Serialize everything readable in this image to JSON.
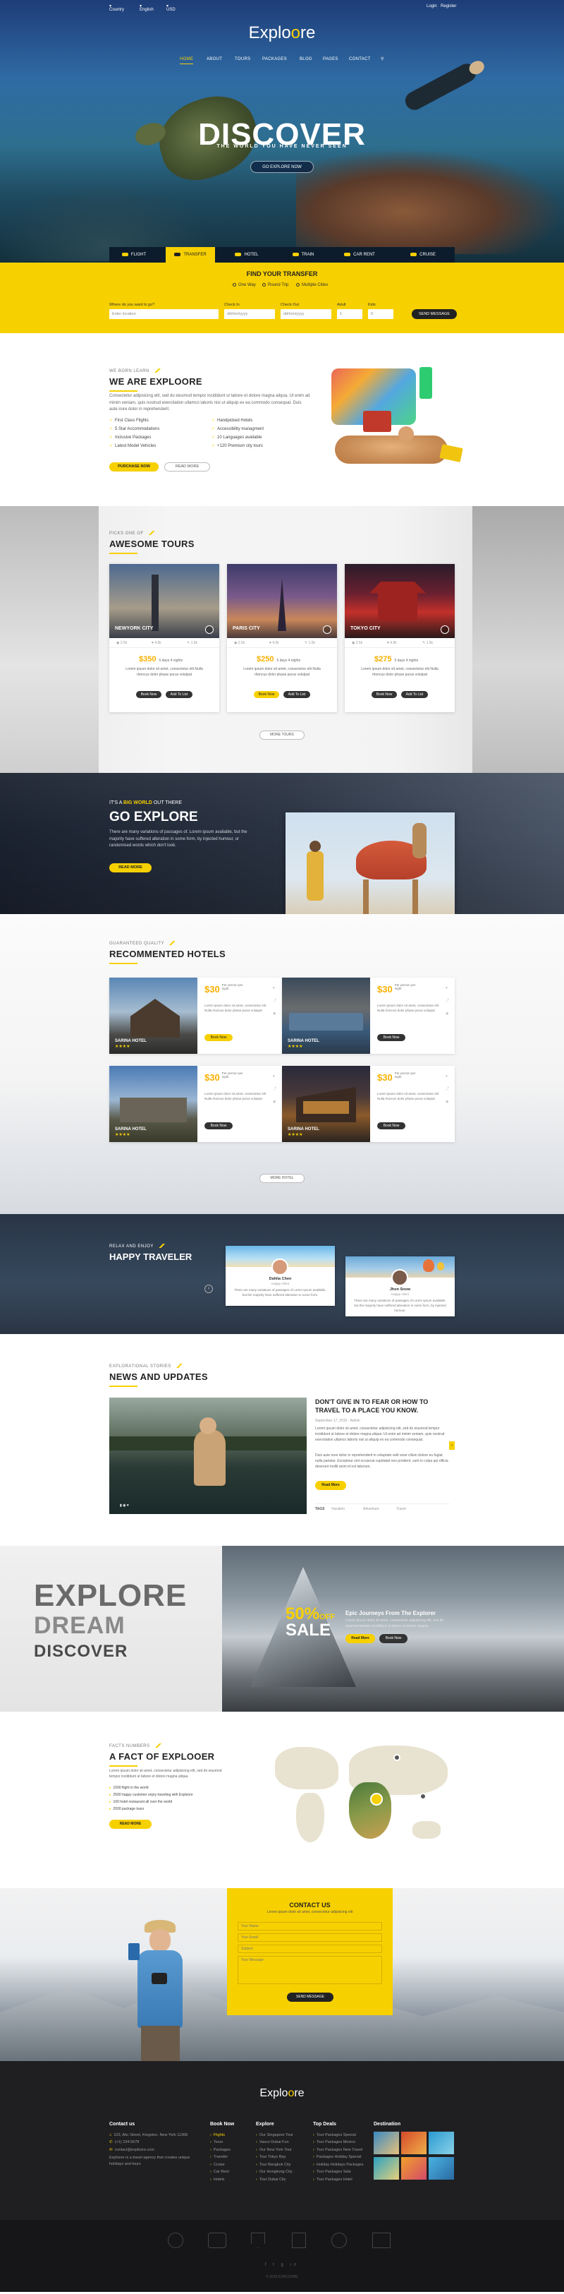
{
  "topbar": {
    "country": "Country",
    "language": "English",
    "currency": "USD",
    "login": "Login",
    "register": "Register"
  },
  "brand": {
    "name_a": "Explo",
    "name_b": "o",
    "name_c": "re"
  },
  "nav": [
    "HOME",
    "ABOUT",
    "TOURS",
    "PACKAGES",
    "BLOG",
    "PAGES",
    "CONTACT"
  ],
  "hero": {
    "title": "DISCOVER",
    "subtitle": "THE WORLD YOU HAVE NEVER SEEN",
    "button": "GO EXPLORE NOW"
  },
  "tabs": [
    "FLIGHT",
    "TRANSFER",
    "HOTEL",
    "TRAIN",
    "CAR RENT",
    "CRUISE"
  ],
  "transfer": {
    "title": "FIND YOUR TRANSFER",
    "radios": [
      "One Way",
      "Round Trip",
      "Multiple Cities"
    ],
    "labels": [
      "Where do you want to go?",
      "Check In",
      "Check Out",
      "Adult",
      "Kids"
    ],
    "placeholders": [
      "Enter location",
      "dd/mm/yyyy",
      "dd/mm/yyyy",
      "1",
      "0"
    ],
    "button": "SEND MESSAGE"
  },
  "about": {
    "eyebrow": "WE BORN LEARN",
    "title": "WE ARE EXPLOORE",
    "text": "Consectetur adipisicing elit, sed do eiusmod tempor incididunt ut labore et dolore magna aliqua. Ut enim ad minim veniam, quis nostrud exercitation ullamco laboris nisi ut aliquip ex ea commodo consequat. Duis aute irure dolor in reprehenderit.",
    "checks": [
      "First Class Flights",
      "5 Star Accommodations",
      "Inclusive Packages",
      "Latest Model Vehicles",
      "Handpicked Hotels",
      "Accessibility managment",
      "10 Languages available",
      "+120 Premium city tours"
    ],
    "btn_primary": "PURCHASE NOW",
    "btn_secondary": "READ MORE"
  },
  "tours": {
    "eyebrow": "PICKS ONE OF",
    "title": "AWESOME TOURS",
    "cards": [
      {
        "city": "NEWYORK CITY",
        "meta": [
          "2.5k",
          "4.5k",
          "1.5k"
        ],
        "price": "$350",
        "nights": "5 days 4 nights",
        "text": "Lorem ipsum dolor sit amet, consectetur elit Nulla rhoncus dolor phase purus volutpat",
        "btn1": "Book Now",
        "btn2": "Add To List"
      },
      {
        "city": "PARIS CITY",
        "meta": [
          "2.5k",
          "4.5k",
          "1.5k"
        ],
        "price": "$250",
        "nights": "5 days 4 nights",
        "text": "Lorem ipsum dolor sit amet, consectetur elit Nulla rhoncus dolor phase purus volutpat",
        "btn1": "Book Now",
        "btn2": "Add To List"
      },
      {
        "city": "TOKYO CITY",
        "meta": [
          "2.5k",
          "4.5k",
          "1.5k"
        ],
        "price": "$275",
        "nights": "5 days 4 nights",
        "text": "Lorem ipsum dolor sit amet, consectetur elit Nulla rhoncus dolor phase purus volutpat",
        "btn1": "Book Now",
        "btn2": "Add To List"
      }
    ],
    "more": "MORE TOURS"
  },
  "goex": {
    "eyebrow_a": "IT'S A",
    "eyebrow_b": "BIG WORLD",
    "eyebrow_c": "OUT THERE",
    "title": "GO EXPLORE",
    "text": "There are many variations of passages of. Lorem ipsum available, but the majority have suffered alteration in some form, by injected humour, or randomised words which don't look.",
    "button": "READ MORE"
  },
  "hotels": {
    "eyebrow": "GUARANTEED QUALITY",
    "title": "RECOMMENTED HOTELS",
    "cards": [
      {
        "name": "SARINA HOTEL",
        "price": "$30",
        "unit": "Per person per night",
        "text": "Lorem ipsum dolor sit amet, consectetur elit Nulla rhoncus dolor phase purus volutpat",
        "btn": "Book Now"
      },
      {
        "name": "SARINA HOTEL",
        "price": "$30",
        "unit": "Per person per night",
        "text": "Lorem ipsum dolor sit amet, consectetur elit Nulla rhoncus dolor phase purus volutpat",
        "btn": "Book Now"
      },
      {
        "name": "SARINA HOTEL",
        "price": "$30",
        "unit": "Per person per night",
        "text": "Lorem ipsum dolor sit amet, consectetur elit Nulla rhoncus dolor phase purus volutpat",
        "btn": "Book Now"
      },
      {
        "name": "SARINA HOTEL",
        "price": "$30",
        "unit": "Per person per night",
        "text": "Lorem ipsum dolor sit amet, consectetur elit Nulla rhoncus dolor phase purus volutpat",
        "btn": "Book Now"
      }
    ],
    "stars": "★★★★",
    "more": "MORE HOTEL"
  },
  "happy": {
    "eyebrow": "RELAX AND ENJOY",
    "title": "HAPPY TRAVELER",
    "quotes": [
      {
        "name": "Dahlia Chen",
        "role": "Happy client",
        "text": "There are many variations of passages of Lorem Ipsum available, but the majority have suffered alteration in some form."
      },
      {
        "name": "Jhon Snow",
        "role": "Happy client",
        "text": "There are many variations of passages of Lorem Ipsum available, but the majority have suffered alteration in some form, by injected humour."
      }
    ]
  },
  "news": {
    "eyebrow": "EXPLORATIONAL STORIES",
    "title": "NEWS AND UPDATES",
    "headline": "DON'T GIVE IN TO FEAR OR HOW TO TRAVEL TO A PLACE YOU KNOW.",
    "date": "September 17, 2015",
    "author": "Admin",
    "p1": "Lorem ipsum dolor sit amet, consectetur adipisicing elit, sed do eiusmod tempor incididunt ut labore et dolore magna aliqua. Ut enim ad minim veniam, quis nostrud exercitation ullamco laboris nisi ut aliquip ex ea commodo consequat.",
    "p2": "Duis aute irure dolor in reprehenderit in voluptate velit esse cillum dolore eu fugiat nulla pariatur. Excepteur sint occaecat cupidatat non proident, sunt in culpa qui officia deserunt mollit anim id est laborum.",
    "button": "Read More",
    "tags_label": "TAGS",
    "tags": [
      "Vacation",
      "Adventure",
      "Travel"
    ]
  },
  "promo": {
    "w1": "EXPLORE",
    "w2": "DREAM",
    "w3": "DISCOVER",
    "pct": "50%",
    "off": "OFF",
    "sale": "SALE",
    "headline": "Epic Journeys From The Explorer",
    "text": "Lorem ipsum dolor sit amet, consectetur adipisicing elit, sed do eiusmod tempor incididunt ut labore et dolore magna.",
    "btn1": "Read More",
    "btn2": "Book Now"
  },
  "fact": {
    "eyebrow": "FACTS NUMBERS",
    "title": "A FACT OF EXPLOOER",
    "text": "Lorem ipsum dolor sit amet, consectetur adipisicing elit, sed do eiusmod tempor incididunt ut labore et dolore magna aliqua.",
    "items": [
      "1000 flight in the world",
      "2500 happy customer enjoy traveling with Exploore",
      "100 hotel restaurant all over the world",
      "2000 package tours"
    ],
    "button": "READ MORE"
  },
  "contact": {
    "title": "CONTACT US",
    "text": "Lorem ipsum dolor sit amet, consectetur adipisicing elit",
    "placeholders": [
      "Your Name",
      "Your Email",
      "Subject",
      "Your Message"
    ],
    "button": "SEND MESSAGE"
  },
  "footer": {
    "cols": [
      "Contact us",
      "Book Now",
      "Explore",
      "Top Deals",
      "Destination"
    ],
    "contact": [
      "123, Abc Street, Kingston, New York 11368",
      "(+1) 234-5678",
      "contact@exploore.com",
      "Exploore is a travel agency that creates unique holidays and tours"
    ],
    "book": [
      "Flights",
      "Tours",
      "Packages",
      "Transfer",
      "Cruise",
      "Car Rent",
      "Hotels"
    ],
    "explore": [
      "Our Singapore Tour",
      "Vasco Dubai Fun",
      "Our New York Tour",
      "Tour Tokyo Bay",
      "Tour Bangkok City",
      "Our Hongkong City",
      "Tour Dubai City"
    ],
    "deals": [
      "Tour Packages Special",
      "Tour Packages Mexico",
      "Tour Packages New Travel",
      "Packages Holiday Special",
      "Holiday Holidays Packages",
      "Tour Packages Sale",
      "Tour Packages Hotel"
    ],
    "copyright": "© 2016 EXPLOORE"
  },
  "colors": {
    "accent": "#f7d000",
    "dark": "#1f1f22"
  }
}
